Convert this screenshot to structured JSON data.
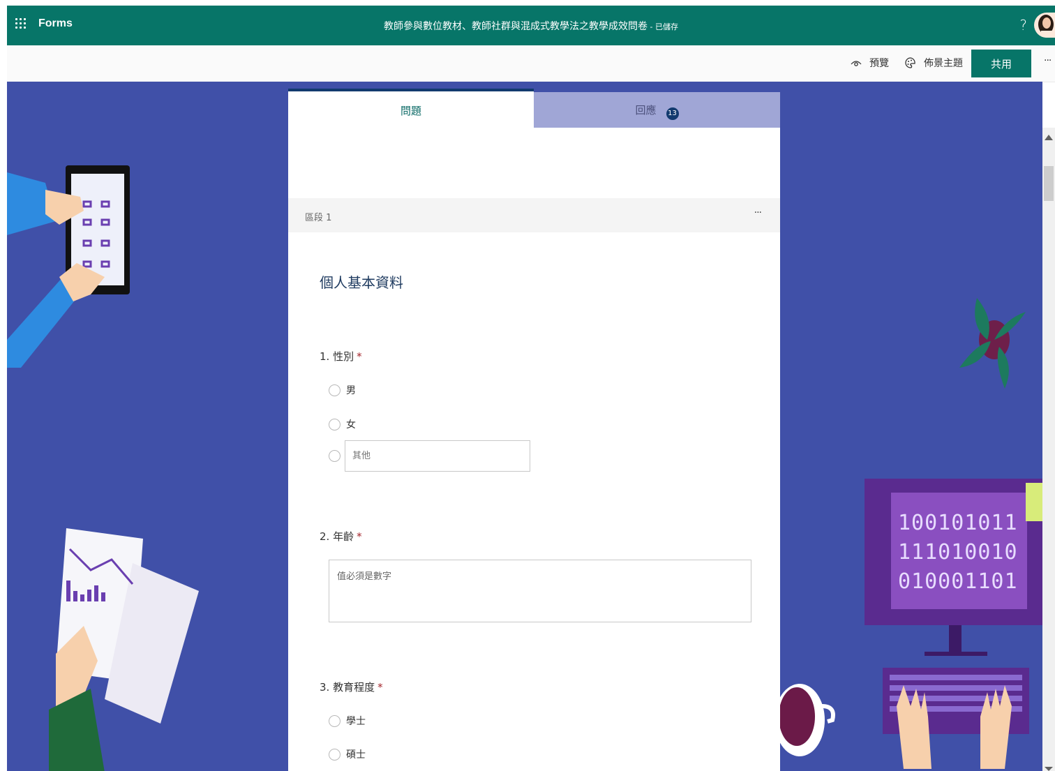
{
  "header": {
    "app_name": "Forms",
    "form_title": "教師參與數位教材、教師社群與混成式教學法之教學成效問卷",
    "save_status": " - 已儲存",
    "help_label": "?"
  },
  "commands": {
    "preview_label": "預覽",
    "theme_label": "佈景主題",
    "share_label": "共用",
    "more_label": "···"
  },
  "tabs": {
    "questions_label": "問題",
    "responses_label": "回應",
    "responses_count": "13"
  },
  "section": {
    "label": "區段 1",
    "more_label": "···",
    "title": "個人基本資料"
  },
  "questions": [
    {
      "number_title": "1. 性別",
      "required_mark": "*",
      "options": [
        "男",
        "女"
      ],
      "other_placeholder": "其他"
    },
    {
      "number_title": "2. 年齡",
      "required_mark": "*",
      "input_placeholder": "值必須是數字"
    },
    {
      "number_title": "3. 教育程度",
      "required_mark": "*",
      "options": [
        "學士",
        "碩士"
      ]
    }
  ],
  "illustration": {
    "binary_lines": [
      "100101011",
      "111010010",
      "010001101"
    ]
  },
  "colors": {
    "brand": "#077568",
    "canvas": "#4050a8",
    "tab_inactive": "#a0a6d6",
    "required": "#a4262c"
  }
}
